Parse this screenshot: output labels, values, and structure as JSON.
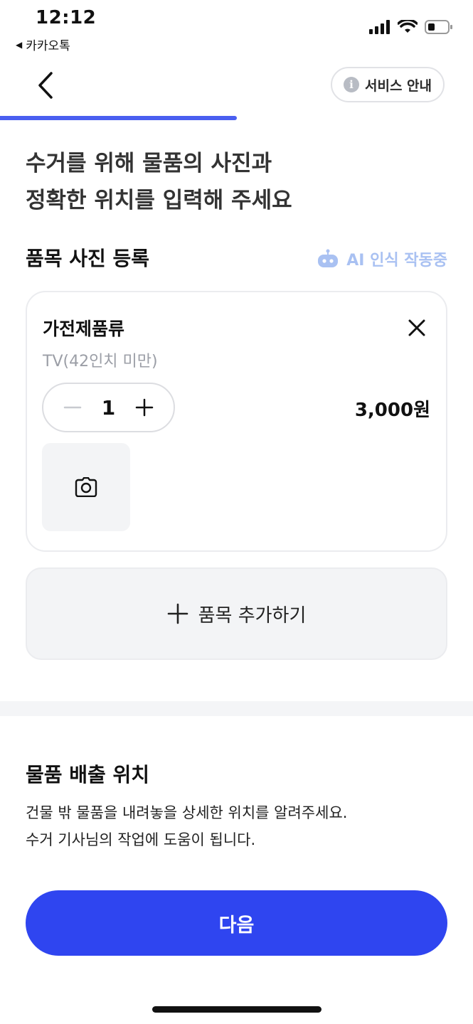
{
  "status_bar": {
    "time": "12:12",
    "back_app": "카카오톡",
    "back_arrow": "◀"
  },
  "header": {
    "service_label": "서비스 안내",
    "info_icon": "i"
  },
  "progress": {
    "fraction": 0.5
  },
  "headline": {
    "line1": "수거를 위해 물품의 사진과",
    "line2": "정확한 위치를 입력해 주세요"
  },
  "photo_section": {
    "title": "품목 사진 등록",
    "ai_status": "AI 인식 작동중"
  },
  "item": {
    "category": "가전제품류",
    "detail": "TV(42인치 미만)",
    "quantity": "1",
    "price": "3,000원"
  },
  "add_item": {
    "label": "품목 추가하기"
  },
  "location": {
    "title": "물품 배출 위치",
    "desc_line1": "건물 밖 물품을 내려놓을 상세한 위치를 알려주세요.",
    "desc_line2": "수거 기사님의 작업에 도움이 됩니다."
  },
  "next_button": {
    "label": "다음"
  },
  "colors": {
    "accent": "#2f45f0",
    "progress": "#4a5ff0",
    "ai_text": "#a9c1f2",
    "card_bg": "#f3f4f6"
  },
  "icons": {
    "back": "chevron-left-icon",
    "info": "info-icon",
    "ai": "robot-icon",
    "close": "close-icon",
    "minus": "minus-icon",
    "plus": "plus-icon",
    "camera": "camera-icon",
    "add": "plus-icon"
  }
}
